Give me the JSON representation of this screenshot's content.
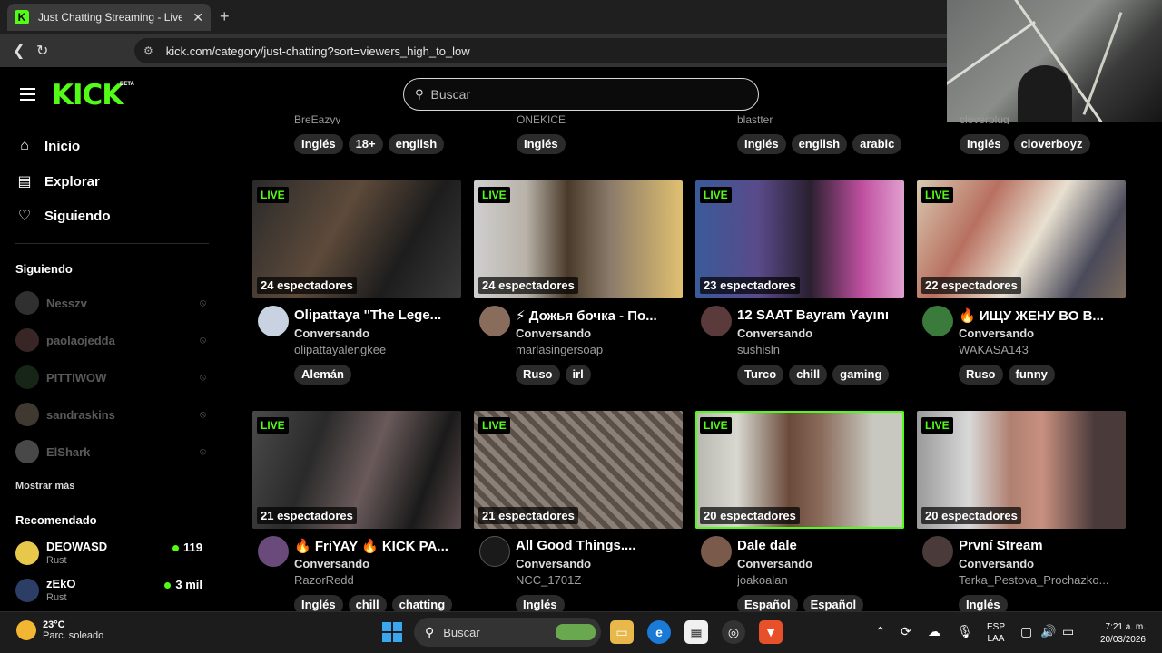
{
  "browser": {
    "tab_title": "Just Chatting Streaming - Live St",
    "tab_favicon": "K",
    "url": "kick.com/category/just-chatting?sort=viewers_high_to_low"
  },
  "header": {
    "logo": "KICK",
    "logo_badge": "BETA",
    "search_placeholder": "Buscar"
  },
  "sidebar": {
    "nav": [
      {
        "label": "Inicio",
        "icon": "home-icon"
      },
      {
        "label": "Explorar",
        "icon": "browse-icon"
      },
      {
        "label": "Siguiendo",
        "icon": "heart-icon"
      }
    ],
    "following_title": "Siguiendo",
    "following": [
      {
        "name": "Nesszv"
      },
      {
        "name": "paolaojedda"
      },
      {
        "name": "PITTIWOW"
      },
      {
        "name": "sandraskins"
      },
      {
        "name": "ElShark"
      }
    ],
    "show_more": "Mostrar más",
    "recommended_title": "Recomendado",
    "recommended": [
      {
        "name": "DEOWASD",
        "category": "Rust",
        "viewers": "119"
      },
      {
        "name": "zEkO",
        "category": "Rust",
        "viewers": "3 mil"
      }
    ]
  },
  "top_row": [
    {
      "user": "BreEazyy",
      "tags": [
        "Inglés",
        "18+",
        "english"
      ]
    },
    {
      "user": "ONEKICE",
      "tags": [
        "Inglés"
      ]
    },
    {
      "user": "blastter",
      "tags": [
        "Inglés",
        "english",
        "arabic"
      ]
    },
    {
      "user": "cloverplug",
      "tags": [
        "Inglés",
        "cloverboyz"
      ]
    }
  ],
  "streams": [
    {
      "live": "LIVE",
      "viewers": "24 espectadores",
      "title": "Olipattaya ''The Lege...",
      "category": "Conversando",
      "user": "olipattayalengkee",
      "tags": [
        "Alemán"
      ]
    },
    {
      "live": "LIVE",
      "viewers": "24 espectadores",
      "title": "⚡ Дожья бочка - По...",
      "category": "Conversando",
      "user": "marlasingersoap",
      "tags": [
        "Ruso",
        "irl"
      ]
    },
    {
      "live": "LIVE",
      "viewers": "23 espectadores",
      "title": "12 SAAT Bayram Yayını",
      "category": "Conversando",
      "user": "sushisln",
      "tags": [
        "Turco",
        "chill",
        "gaming"
      ]
    },
    {
      "live": "LIVE",
      "viewers": "22 espectadores",
      "title": "🔥 ИЩУ ЖЕНУ ВО В...",
      "category": "Conversando",
      "user": "WAKASA143",
      "tags": [
        "Ruso",
        "funny"
      ]
    },
    {
      "live": "LIVE",
      "viewers": "21 espectadores",
      "title": "🔥 FriYAY 🔥 KICK PA...",
      "category": "Conversando",
      "user": "RazorRedd",
      "tags": [
        "Inglés",
        "chill",
        "chatting"
      ]
    },
    {
      "live": "LIVE",
      "viewers": "21 espectadores",
      "title": "All Good Things....",
      "category": "Conversando",
      "user": "NCC_1701Z",
      "tags": [
        "Inglés"
      ]
    },
    {
      "live": "LIVE",
      "viewers": "20 espectadores",
      "title": "Dale dale",
      "category": "Conversando",
      "user": "joakoalan",
      "tags": [
        "Español",
        "Español"
      ]
    },
    {
      "live": "LIVE",
      "viewers": "20 espectadores",
      "title": "První Stream",
      "category": "Conversando",
      "user": "Terka_Pestova_Prochazko...",
      "tags": [
        "Inglés"
      ]
    }
  ],
  "taskbar": {
    "temperature": "23°C",
    "weather": "Parc. soleado",
    "search": "Buscar",
    "lang_1": "ESP",
    "lang_2": "LAA",
    "time": "7:21 a. m.",
    "date": "20/03/2026"
  },
  "colors": {
    "accent": "#53fc18",
    "background": "#000000",
    "tag_bg": "#2b2b2b"
  }
}
